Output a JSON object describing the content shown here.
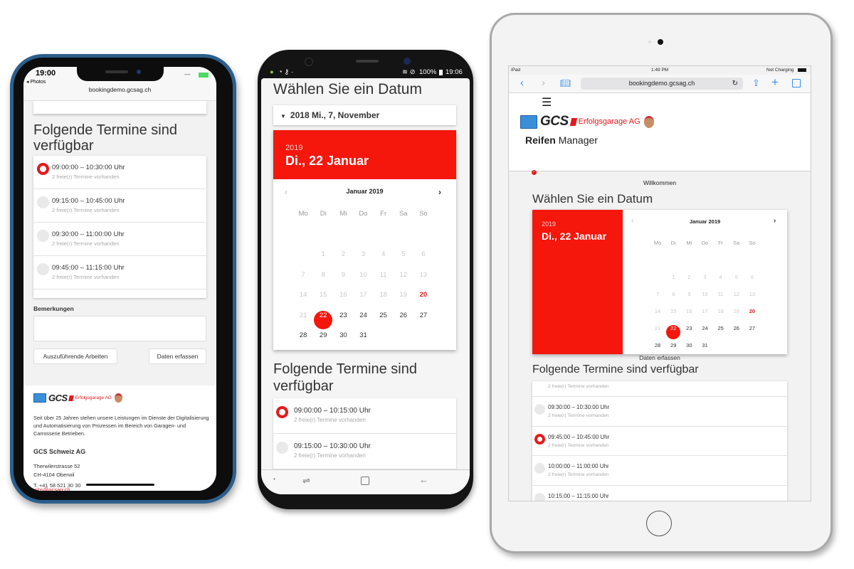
{
  "iphone": {
    "status": {
      "time": "19:00",
      "back_label": "◂ Photos",
      "url": "bookingdemo.gcsag.ch"
    },
    "heading": "Folgende Termine sind verfügbar",
    "slots": [
      {
        "time": "09:00:00 – 10:30:00 Uhr",
        "sub": "2 freie(r) Termine vorhanden",
        "selected": true
      },
      {
        "time": "09:15:00 – 10:45:00 Uhr",
        "sub": "2 freie(r) Termine vorhanden",
        "selected": false
      },
      {
        "time": "09:30:00 – 11:00:00 Uhr",
        "sub": "2 freie(r) Termine vorhanden",
        "selected": false
      },
      {
        "time": "09:45:00 – 11:15:00 Uhr",
        "sub": "2 freie(r) Termine vorhanden",
        "selected": false
      }
    ],
    "remarks_label": "Bemerkungen",
    "remarks_value": "",
    "btn_work": "Auszuführende Arbeiten",
    "btn_submit": "Daten erfassen",
    "footer": {
      "logo_gcs": "GCS",
      "logo_erfolg": "Erfolgsgarage AG",
      "text": "Seit über 25 Jahren stehen unsere Leistungen im Dienste der Digitalisierung und Automatisierung von Prozessen im Bereich von Garagen- und Carrosserie Betrieben.",
      "company": "GCS Schweiz AG",
      "street": "Therwilerstrasse 52",
      "city": "CH-4104 Oberwil",
      "phone": "T. +41 58 521 30 30",
      "email": "jobs@gcsag.ch"
    }
  },
  "samsung": {
    "status": {
      "left_icons": "● ◔ ⚷ ·",
      "right": "100%",
      "time": "19:06"
    },
    "heading": "Wählen Sie ein Datum",
    "dropdown": "2018 Mi., 7, November",
    "picker": {
      "year": "2019",
      "date": "Di., 22 Januar",
      "month": "Januar 2019"
    },
    "heading2": "Folgende Termine sind verfügbar",
    "slots": [
      {
        "time": "09:00:00 – 10:15:00 Uhr",
        "sub": "2 freie(r) Termine vorhanden",
        "selected": true
      },
      {
        "time": "09:15:00 – 10:30:00 Uhr",
        "sub": "2 freie(r) Termine vorhanden",
        "selected": false
      }
    ]
  },
  "calendar": {
    "weekdays": [
      "Mo",
      "Di",
      "Mi",
      "Do",
      "Fr",
      "Sa",
      "So"
    ],
    "first_weekday_offset": 1,
    "days_in_month": 31,
    "disabled_until": 21,
    "today": 20,
    "selected": 22
  },
  "ipad": {
    "status": {
      "device": "iPad",
      "time": "1:49 PM",
      "battery": "Not Charging"
    },
    "url": "bookingdemo.gcsag.ch",
    "logo_gcs": "GCS",
    "logo_erfolg": "Erfolgsgarage AG",
    "app_name_bold": "Reifen",
    "app_name": "Manager",
    "welcome": "Willkommen",
    "heading": "Wählen Sie ein Datum",
    "picker": {
      "year": "2019",
      "date": "Di., 22 Januar",
      "month": "Januar 2019"
    },
    "submit": "Daten erfassen",
    "heading2": "Folgende Termine sind verfügbar",
    "partial_sub": "2 freie(r) Termine vorhanden",
    "slots": [
      {
        "time": "09:30:00 – 10:30:00 Uhr",
        "sub": "2 freie(r) Termine vorhanden",
        "selected": false
      },
      {
        "time": "09:45:00 – 10:45:00 Uhr",
        "sub": "2 freie(r) Termine vorhanden",
        "selected": true
      },
      {
        "time": "10:00:00 – 11:00:00 Uhr",
        "sub": "2 freie(r) Termine vorhanden",
        "selected": false
      },
      {
        "time": "10:15:00 – 11:15:00 Uhr",
        "sub": "",
        "selected": false
      }
    ]
  },
  "colors": {
    "accent": "#f5160c",
    "radio_red": "#e3191c",
    "ios_blue": "#3a8ee6"
  }
}
